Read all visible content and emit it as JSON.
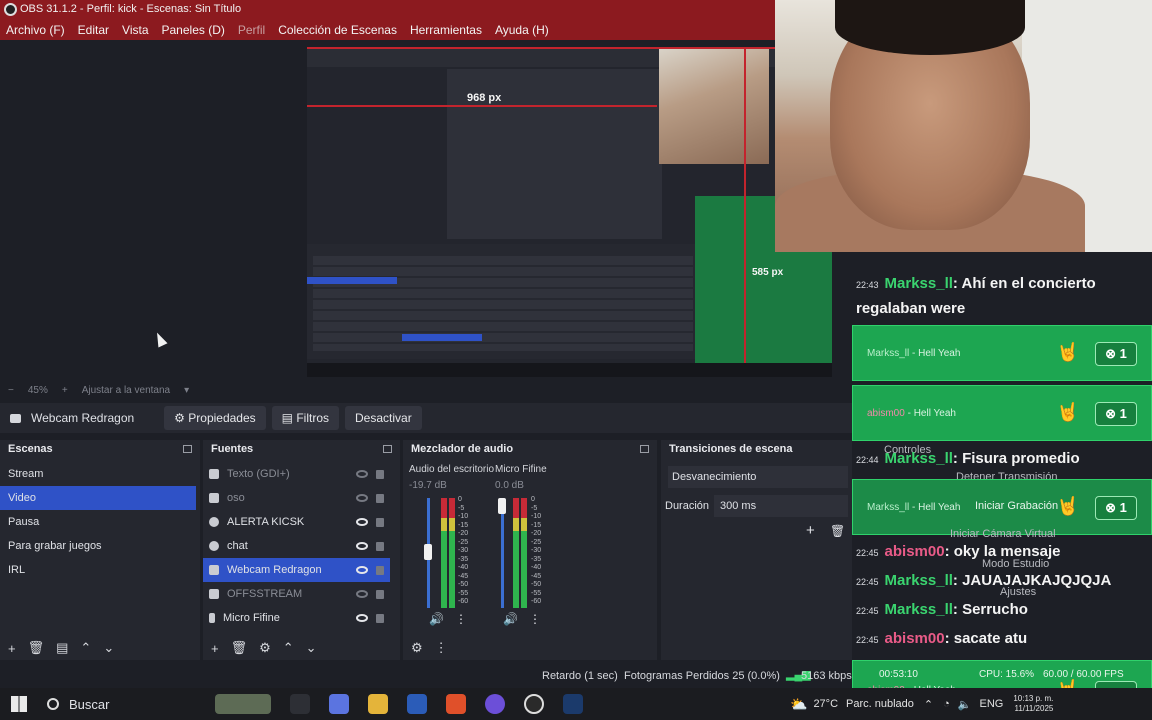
{
  "window": {
    "title": "OBS 31.1.2 - Perfil: kick - Escenas: Sin Título"
  },
  "menu": [
    "Archivo (F)",
    "Editar",
    "Vista",
    "Paneles (D)",
    "Perfil",
    "Colección de Escenas",
    "Herramientas",
    "Ayuda (H)"
  ],
  "preview": {
    "measure_h": "968 px",
    "measure_v": "585 px",
    "zoom": "45%",
    "fit": "Ajustar a la ventana"
  },
  "source_bar": {
    "selected": "Webcam Redragon",
    "properties": "Propiedades",
    "filters": "Filtros",
    "deactivate": "Desactivar"
  },
  "scenes": {
    "title": "Escenas",
    "items": [
      "Stream",
      "Video",
      "Pausa",
      "Para grabar juegos",
      "IRL"
    ],
    "selected_index": 1
  },
  "sources": {
    "title": "Fuentes",
    "items": [
      {
        "name": "Texto (GDI+)",
        "visible": false
      },
      {
        "name": "oso",
        "visible": false
      },
      {
        "name": "ALERTA KICSK",
        "visible": true
      },
      {
        "name": "chat",
        "visible": true
      },
      {
        "name": "Webcam Redragon",
        "visible": true
      },
      {
        "name": "OFFSSTREAM",
        "visible": false
      },
      {
        "name": "Micro Fifine",
        "visible": true
      }
    ],
    "selected_index": 4
  },
  "mixer": {
    "title": "Mezclador de audio",
    "channels": [
      {
        "name": "Audio del escritorio",
        "db": "-19.7 dB",
        "level": 0.55
      },
      {
        "name": "Micro Fifine",
        "db": "0.0 dB",
        "level": 0.95
      }
    ],
    "scale": [
      "0",
      "-5",
      "-10",
      "-15",
      "-20",
      "-25",
      "-30",
      "-35",
      "-40",
      "-45",
      "-50",
      "-55",
      "-60"
    ]
  },
  "transitions": {
    "title": "Transiciones de escena",
    "type": "Desvanecimiento",
    "duration_label": "Duración",
    "duration_value": "300 ms"
  },
  "controls": {
    "title": "Controles",
    "stop_stream": "Detener Transmisión",
    "start_record": "Iniciar Grabación",
    "virtual_cam": "Iniciar Cámara Virtual",
    "studio_mode": "Modo Estudio",
    "settings": "Ajustes"
  },
  "chat": {
    "messages": [
      {
        "time": "22:43",
        "user": "Markss_ll",
        "text": ": Ahí en el concierto regalaban were",
        "color": "green"
      },
      {
        "time": "22:44",
        "user": "Markss_ll",
        "text": ": Fisura promedio",
        "color": "green"
      },
      {
        "time": "22:45",
        "user": "abism00",
        "text": ": oky la mensaje",
        "color": "pink"
      },
      {
        "time": "22:45",
        "user": "Markss_ll",
        "text": ": JAUAJAJKAJQJQJA",
        "color": "green"
      },
      {
        "time": "22:45",
        "user": "Markss_ll",
        "text": ": Serrucho",
        "color": "green"
      },
      {
        "time": "22:45",
        "user": "abism00",
        "text": ": sacate atu",
        "color": "pink"
      }
    ],
    "alerts": [
      {
        "user": "Markss_ll",
        "text": "- Hell Yeah",
        "count": "1"
      },
      {
        "user": "abism00",
        "text": "- Hell Yeah",
        "count": "1"
      },
      {
        "user": "Markss_ll",
        "text": "- Hell Yeah",
        "count": "1"
      },
      {
        "user": "abism00",
        "text": "- Hell Yeah",
        "count": "1"
      }
    ]
  },
  "status": {
    "delay": "Retardo (1 sec)",
    "dropped": "Fotogramas Perdidos 25 (0.0%)",
    "bitrate": "5163 kbps",
    "time": "00:53:10",
    "cpu": "CPU: 15.6%",
    "fps": "60.00 / 60.00 FPS"
  },
  "taskbar": {
    "search": "Buscar",
    "weather": "27°C",
    "weather_desc": "Parc. nublado",
    "lang": "ENG",
    "clock_date": "11/11/2025",
    "clock_time": "10:13 p. m."
  },
  "colors": {
    "titlebar": "#8c1a1f",
    "selection": "#2f52c7",
    "alert_green": "#1da651",
    "user_green": "#3ad46f",
    "user_pink": "#ea5b88"
  }
}
